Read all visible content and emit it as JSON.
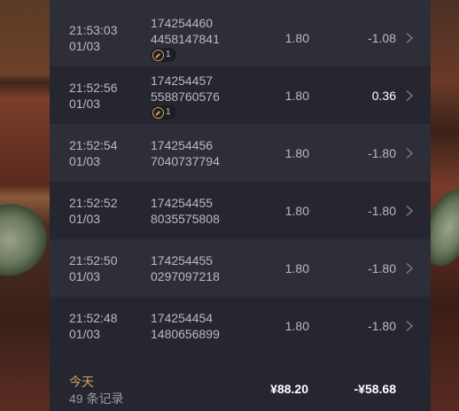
{
  "rows": [
    {
      "time": "21:53:03",
      "date": "01/03",
      "id_line1": "174254460",
      "id_line2": "4458147841",
      "badge": "1",
      "amount": "1.80",
      "result": "-1.08",
      "positive": false
    },
    {
      "time": "21:52:56",
      "date": "01/03",
      "id_line1": "174254457",
      "id_line2": "5588760576",
      "badge": "1",
      "amount": "1.80",
      "result": "0.36",
      "positive": true
    },
    {
      "time": "21:52:54",
      "date": "01/03",
      "id_line1": "174254456",
      "id_line2": "7040737794",
      "badge": null,
      "amount": "1.80",
      "result": "-1.80",
      "positive": false
    },
    {
      "time": "21:52:52",
      "date": "01/03",
      "id_line1": "174254455",
      "id_line2": "8035575808",
      "badge": null,
      "amount": "1.80",
      "result": "-1.80",
      "positive": false
    },
    {
      "time": "21:52:50",
      "date": "01/03",
      "id_line1": "174254455",
      "id_line2": "0297097218",
      "badge": null,
      "amount": "1.80",
      "result": "-1.80",
      "positive": false
    },
    {
      "time": "21:52:48",
      "date": "01/03",
      "id_line1": "174254454",
      "id_line2": "1480656899",
      "badge": null,
      "amount": "1.80",
      "result": "-1.80",
      "positive": false
    }
  ],
  "footer": {
    "label": "今天",
    "count": "49 条记录",
    "total": "¥88.20",
    "result": "-¥58.68"
  },
  "icons": {
    "badge_icon": "multiplier-icon",
    "row_chevron": "chevron-right-icon"
  },
  "colors": {
    "panel_bg": "#262630",
    "row_alt_bg": "#2e2e38",
    "accent": "#d9a35a",
    "text_muted": "#b9b9c2"
  }
}
